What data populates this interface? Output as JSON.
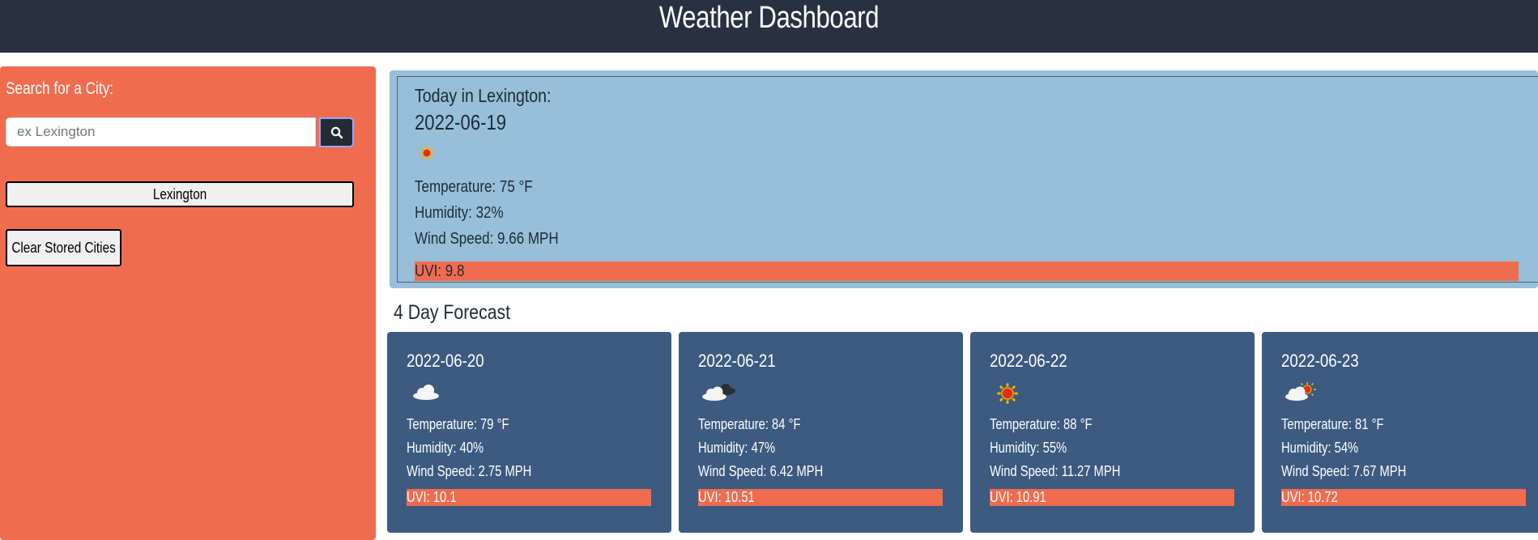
{
  "header": {
    "title": "Weather Dashboard"
  },
  "sidebar": {
    "title": "Search for a City:",
    "search_placeholder": "ex Lexington",
    "search_icon": "search-icon",
    "stored_cities": [
      "Lexington"
    ],
    "clear_label": "Clear Stored Cities"
  },
  "today": {
    "heading": "Today in Lexington:",
    "date": "2022-06-19",
    "icon": "sun-icon",
    "temperature": "Temperature: 75 °F",
    "humidity": "Humidity: 32%",
    "wind": "Wind Speed: 9.66 MPH",
    "uvi": "UVI: 9.8"
  },
  "forecast": {
    "title": "4 Day Forecast",
    "days": [
      {
        "date": "2022-06-20",
        "icon": "cloud-icon",
        "temperature": "Temperature: 79 °F",
        "humidity": "Humidity: 40%",
        "wind": "Wind Speed: 2.75 MPH",
        "uvi": "UVI: 10.1"
      },
      {
        "date": "2022-06-21",
        "icon": "dark-cloud-icon",
        "temperature": "Temperature: 84 °F",
        "humidity": "Humidity: 47%",
        "wind": "Wind Speed: 6.42 MPH",
        "uvi": "UVI: 10.51"
      },
      {
        "date": "2022-06-22",
        "icon": "sun-icon",
        "temperature": "Temperature: 88 °F",
        "humidity": "Humidity: 55%",
        "wind": "Wind Speed: 11.27 MPH",
        "uvi": "UVI: 10.91"
      },
      {
        "date": "2022-06-23",
        "icon": "partly-cloudy-icon",
        "temperature": "Temperature: 81 °F",
        "humidity": "Humidity: 54%",
        "wind": "Wind Speed: 7.67 MPH",
        "uvi": "UVI: 10.72"
      }
    ]
  },
  "colors": {
    "header_bg": "#283142",
    "accent": "#ef6c4f",
    "today_bg": "#97bfd9",
    "card_bg": "#3d5a80"
  }
}
